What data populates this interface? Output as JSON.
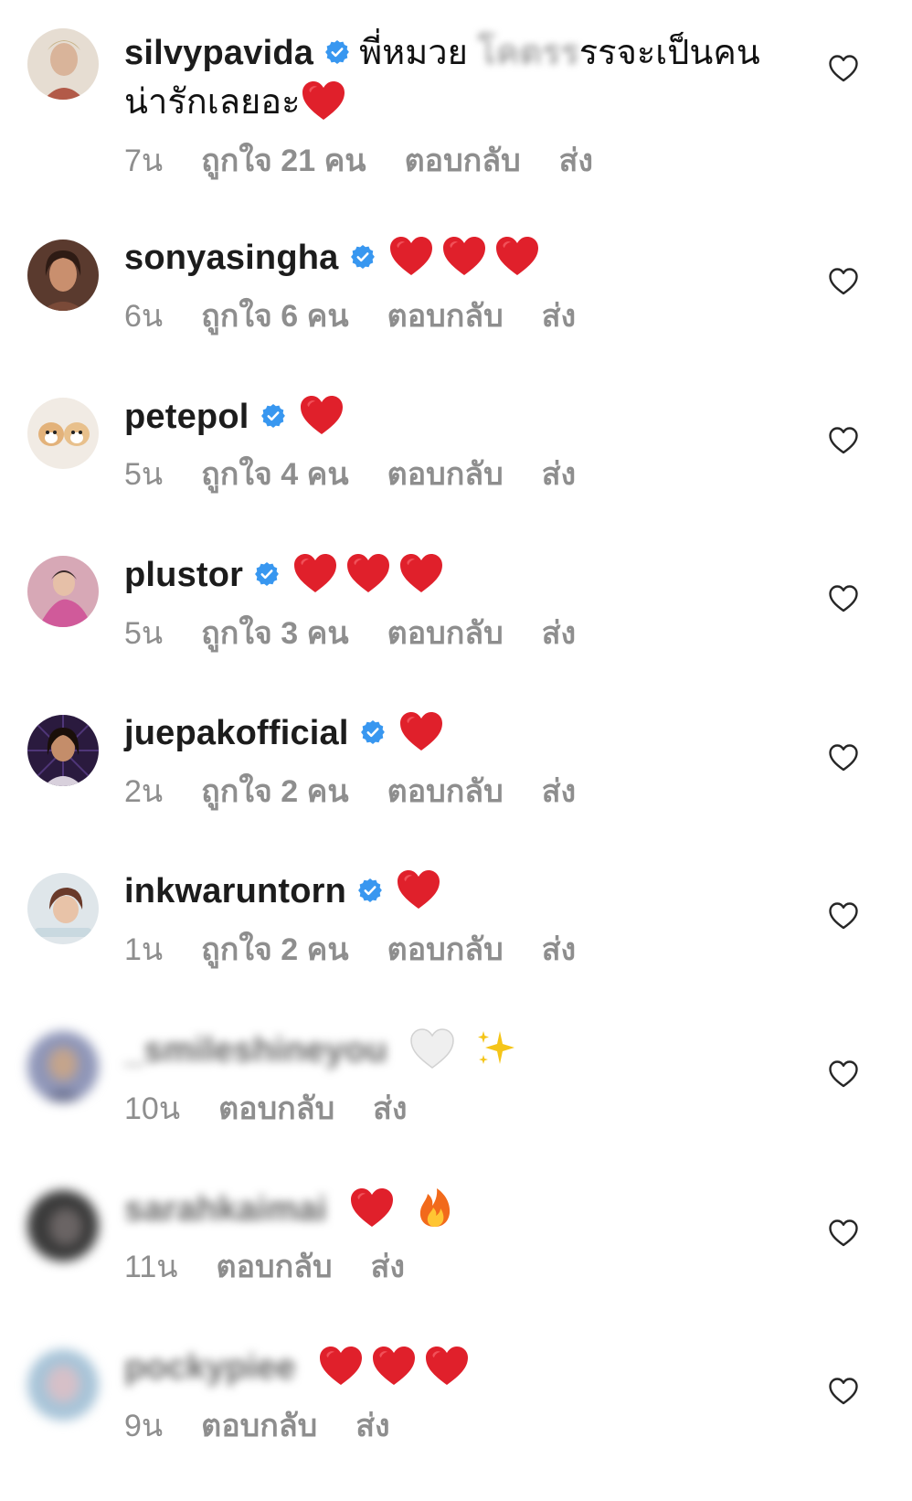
{
  "colors": {
    "verified": "#3897f0",
    "heart_red": "#e0202b",
    "meta_gray": "#8e8e8e"
  },
  "comments": [
    {
      "username": "silvypavida",
      "verified": true,
      "text_part1": "พี่หมวย",
      "text_masked": "โคตรร",
      "text_part2": "รรจะเป็นคน",
      "text_line2": "น่ารักเลยอะ",
      "emoji_after_line2": "heart-red",
      "time": "7น",
      "likes": "ถูกใจ 21 คน",
      "reply": "ตอบกลับ",
      "send": "ส่ง"
    },
    {
      "username": "sonyasingha",
      "verified": true,
      "hearts": 3,
      "time": "6น",
      "likes": "ถูกใจ 6 คน",
      "reply": "ตอบกลับ",
      "send": "ส่ง"
    },
    {
      "username": "petepol",
      "verified": true,
      "hearts": 1,
      "time": "5น",
      "likes": "ถูกใจ 4 คน",
      "reply": "ตอบกลับ",
      "send": "ส่ง"
    },
    {
      "username": "plustor",
      "verified": true,
      "hearts": 3,
      "time": "5น",
      "likes": "ถูกใจ 3 คน",
      "reply": "ตอบกลับ",
      "send": "ส่ง"
    },
    {
      "username": "juepakofficial",
      "verified": true,
      "hearts": 1,
      "time": "2น",
      "likes": "ถูกใจ 2 คน",
      "reply": "ตอบกลับ",
      "send": "ส่ง"
    },
    {
      "username": "inkwaruntorn",
      "verified": true,
      "hearts": 1,
      "time": "1น",
      "likes": "ถูกใจ 2 คน",
      "reply": "ตอบกลับ",
      "send": "ส่ง"
    },
    {
      "username": "_smileshineyou",
      "blurred": true,
      "emojis": "🤍✨",
      "time": "10น",
      "reply": "ตอบกลับ",
      "send": "ส่ง"
    },
    {
      "username": "sarahkaimai",
      "blurred": true,
      "emojis": "🔥",
      "hearts": 1,
      "time": "11น",
      "reply": "ตอบกลับ",
      "send": "ส่ง"
    },
    {
      "username": "pockypiee",
      "blurred": true,
      "hearts": 3,
      "time": "9น",
      "reply": "ตอบกลับ",
      "send": "ส่ง"
    }
  ]
}
